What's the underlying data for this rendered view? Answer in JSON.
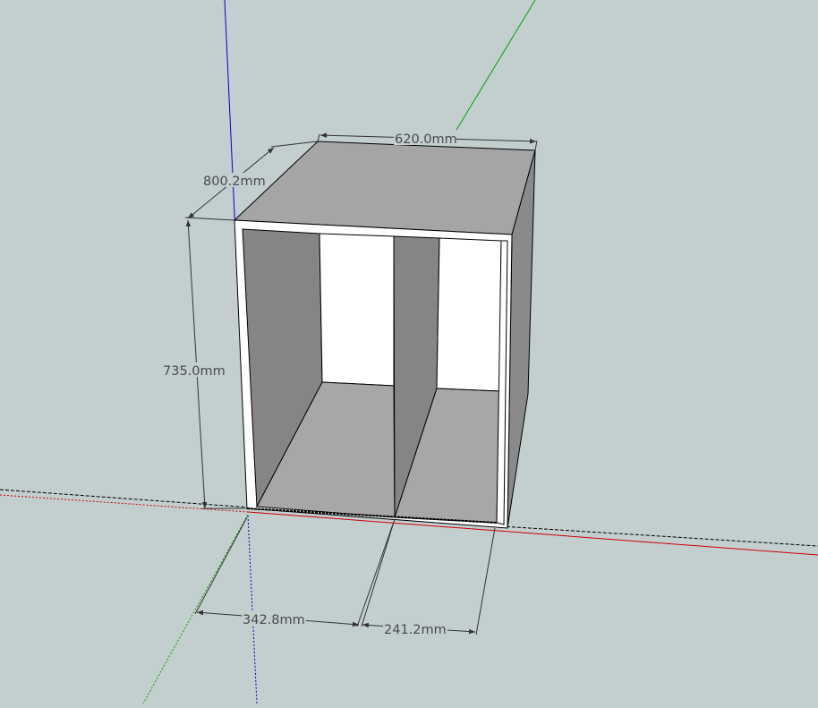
{
  "viewport": {
    "background_color": "#c3cfcf",
    "axis_colors": {
      "x_axis": "#cc0000",
      "y_axis": "#00a000",
      "z_axis": "#0000cc"
    }
  },
  "model": {
    "face_colors": {
      "top": "#a5a5a5",
      "side_inner": "#858585",
      "floor": "#a7a7a7",
      "back_panel": "#ffffff",
      "edge": "#000000"
    }
  },
  "dimensions": {
    "width": "620.0mm",
    "depth": "800.2mm",
    "height": "735.0mm",
    "left_compartment": "342.8mm",
    "right_compartment": "241.2mm"
  }
}
